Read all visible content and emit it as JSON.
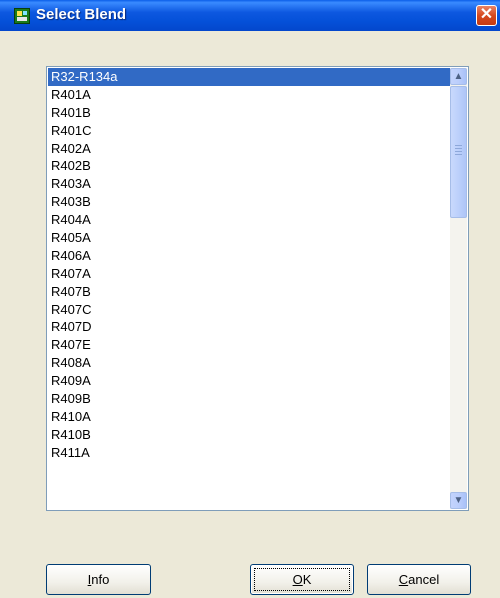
{
  "window": {
    "title": "Select Blend"
  },
  "blend_list": {
    "selected_index": 0,
    "items": [
      "R32-R134a",
      "R401A",
      "R401B",
      "R401C",
      "R402A",
      "R402B",
      "R403A",
      "R403B",
      "R404A",
      "R405A",
      "R406A",
      "R407A",
      "R407B",
      "R407C",
      "R407D",
      "R407E",
      "R408A",
      "R409A",
      "R409B",
      "R410A",
      "R410B",
      "R411A"
    ]
  },
  "buttons": {
    "info": "Info",
    "ok": "OK",
    "cancel": "Cancel"
  },
  "colors": {
    "selection": "#316ac5",
    "titlebar": "#0450d8",
    "close": "#d6491f"
  },
  "icons": {
    "app": "app-icon",
    "close": "close-icon",
    "scroll_up": "chevron-up-icon",
    "scroll_down": "chevron-down-icon"
  }
}
